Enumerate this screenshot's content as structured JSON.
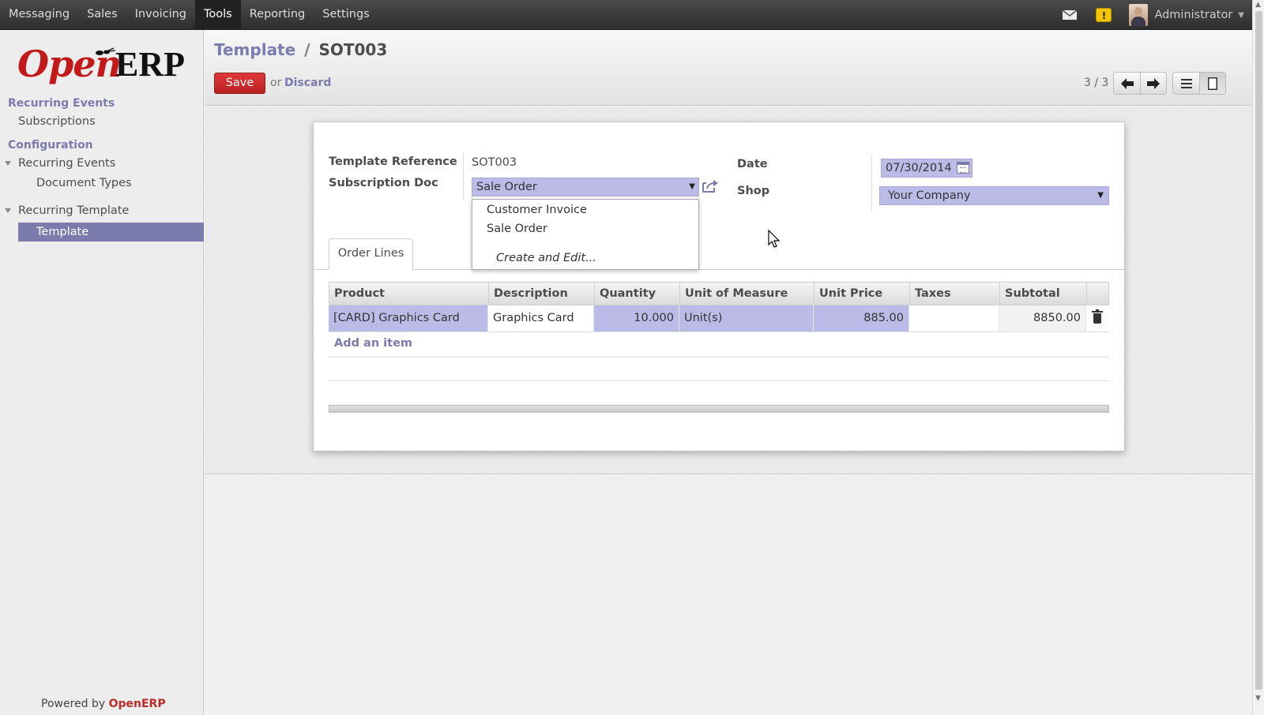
{
  "topbar": {
    "menu": [
      "Messaging",
      "Sales",
      "Invoicing",
      "Tools",
      "Reporting",
      "Settings"
    ],
    "active_menu": "Tools",
    "warning_badge": "!",
    "user": "Administrator"
  },
  "sidebar": {
    "logo_open": "Open",
    "logo_erp": "ERP",
    "section1": "Recurring Events",
    "subscriptions": "Subscriptions",
    "section2": "Configuration",
    "recurring_events": "Recurring Events",
    "document_types": "Document Types",
    "recurring_template": "Recurring Template",
    "template": "Template",
    "powered_by": "Powered by",
    "powered_brand": "OpenERP"
  },
  "header": {
    "breadcrumb_parent": "Template",
    "breadcrumb_sep": "/",
    "breadcrumb_current": "SOT003",
    "save_label": "Save",
    "or_label": "or",
    "discard_label": "Discard",
    "pager": "3 / 3"
  },
  "form": {
    "template_reference_label": "Template Reference",
    "template_reference_value": "SOT003",
    "subscription_doc_label": "Subscription Doc",
    "subscription_doc_value": "Sale Order",
    "date_label": "Date",
    "date_value": "07/30/2014",
    "shop_label": "Shop",
    "shop_value": "Your Company",
    "dropdown_options": [
      "Customer Invoice",
      "Sale Order"
    ],
    "dropdown_create": "Create and Edit..."
  },
  "tabs": {
    "order_lines": "Order Lines"
  },
  "table": {
    "columns": [
      "Product",
      "Description",
      "Quantity",
      "Unit of Measure",
      "Unit Price",
      "Taxes",
      "Subtotal"
    ],
    "rows": [
      {
        "product": "[CARD] Graphics Card",
        "description": "Graphics Card",
        "quantity": "10.000",
        "uom": "Unit(s)",
        "unit_price": "885.00",
        "taxes": "",
        "subtotal": "8850.00"
      }
    ],
    "add_item": "Add an item"
  },
  "colors": {
    "accent": "#7c7bad",
    "highlight_field": "#bcbbe8",
    "save_button": "#c82828",
    "brand_red": "#c21a1a"
  }
}
